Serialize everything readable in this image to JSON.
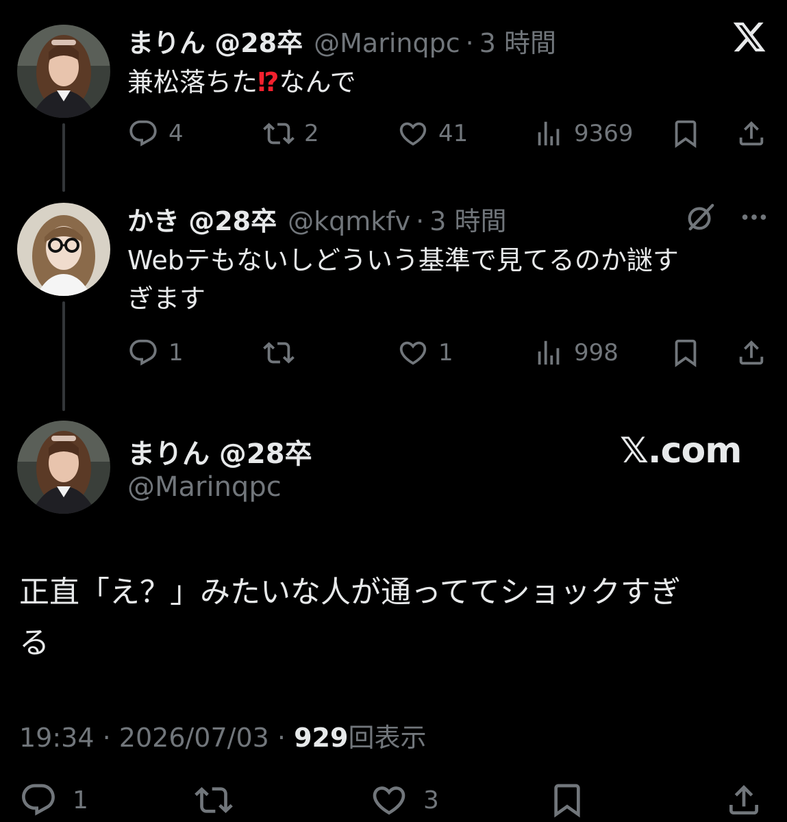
{
  "tweet1": {
    "name": "まりん @28卒",
    "handle": "@Marinqpc",
    "separator": "·",
    "time": "3 時間",
    "text_before": "兼松落ちた",
    "text_emoji": "⁉",
    "text_after": "なんで",
    "replies": "4",
    "retweets": "2",
    "likes": "41",
    "views": "9369"
  },
  "tweet2": {
    "name": "かき @28卒",
    "handle": "@kqmkfv",
    "separator": "·",
    "time": "3 時間",
    "text_line1": "Webテもないしどういう基準で見てるのか謎す",
    "text_line2": "ぎます",
    "replies": "1",
    "retweets": "",
    "likes": "1",
    "views": "998"
  },
  "main_tweet": {
    "name": "まりん @28卒",
    "handle": "@Marinqpc",
    "brand": "𝕏.com",
    "text_line1": "正直「え？」みたいな人が通っててショックすぎ",
    "text_line2": "る",
    "time": "19:34",
    "separator": "·",
    "date": "2026/07/03",
    "views_count": "929",
    "views_label": "回表示",
    "replies": "1",
    "likes": "3"
  },
  "icons": {
    "reply": "reply-icon",
    "retweet": "retweet-icon",
    "like": "heart-icon",
    "views": "views-icon",
    "bookmark": "bookmark-icon",
    "share": "share-icon",
    "x_logo": "x-logo-icon",
    "grok": "grok-icon",
    "more": "more-icon"
  },
  "colors": {
    "background": "#000000",
    "text_primary": "#e7e9ea",
    "text_secondary": "#71767b",
    "thread_line": "#333639",
    "emoji_red": "#f4212e"
  }
}
